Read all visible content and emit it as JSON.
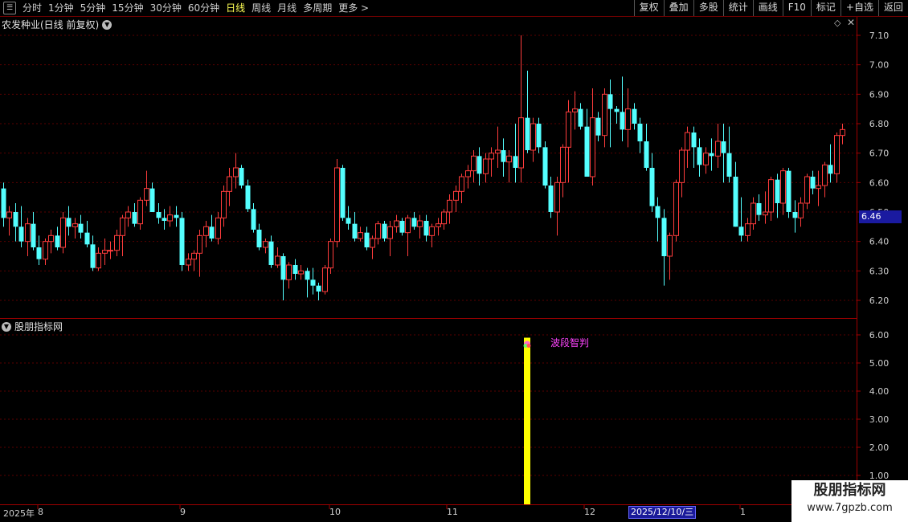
{
  "toolbar": {
    "periods": [
      "分时",
      "1分钟",
      "5分钟",
      "15分钟",
      "30分钟",
      "60分钟",
      "日线",
      "周线",
      "月线",
      "多周期",
      "更多 >"
    ],
    "active_period": "日线",
    "right_buttons": [
      "复权",
      "叠加",
      "多股",
      "统计",
      "画线",
      "F10",
      "标记",
      "+自选",
      "返回"
    ]
  },
  "main_panel": {
    "title": "农发种业(日线 前复权)",
    "y_ticks": [
      "7.10",
      "7.00",
      "6.90",
      "6.80",
      "6.70",
      "6.60",
      "6.50",
      "6.40",
      "6.30",
      "6.20"
    ],
    "current_price": "6.46"
  },
  "indicator_panel": {
    "title": "股朋指标网",
    "y_ticks": [
      "6.00",
      "5.00",
      "4.00",
      "3.00",
      "2.00",
      "1.00"
    ],
    "signal_label": "波段智判"
  },
  "x_axis": {
    "labels": [
      "2025年",
      "8",
      "9",
      "10",
      "11",
      "12",
      "1"
    ],
    "cursor_date": "2025/12/10/三"
  },
  "watermark": {
    "line1": "股朋指标网",
    "line2": "www.7gpzb.com"
  },
  "colors": {
    "up": "#ff3c3c",
    "down": "#54ffff",
    "indicator_bar": "#ffff00",
    "grid": "#5a0000"
  },
  "chart_data": {
    "type": "candlestick",
    "ylim": [
      6.15,
      7.15
    ],
    "candles": [
      [
        6.58,
        6.6,
        6.45,
        6.48
      ],
      [
        6.48,
        6.52,
        6.42,
        6.5
      ],
      [
        6.5,
        6.53,
        6.4,
        6.45
      ],
      [
        6.45,
        6.52,
        6.38,
        6.4
      ],
      [
        6.4,
        6.48,
        6.35,
        6.46
      ],
      [
        6.46,
        6.5,
        6.37,
        6.38
      ],
      [
        6.38,
        6.42,
        6.32,
        6.34
      ],
      [
        6.34,
        6.41,
        6.32,
        6.4
      ],
      [
        6.4,
        6.44,
        6.36,
        6.42
      ],
      [
        6.42,
        6.45,
        6.37,
        6.38
      ],
      [
        6.38,
        6.5,
        6.36,
        6.48
      ],
      [
        6.48,
        6.52,
        6.42,
        6.45
      ],
      [
        6.45,
        6.48,
        6.41,
        6.46
      ],
      [
        6.46,
        6.49,
        6.41,
        6.43
      ],
      [
        6.43,
        6.47,
        6.38,
        6.39
      ],
      [
        6.39,
        6.42,
        6.3,
        6.31
      ],
      [
        6.31,
        6.38,
        6.3,
        6.36
      ],
      [
        6.36,
        6.41,
        6.32,
        6.37
      ],
      [
        6.37,
        6.4,
        6.34,
        6.37
      ],
      [
        6.37,
        6.44,
        6.35,
        6.42
      ],
      [
        6.42,
        6.49,
        6.35,
        6.48
      ],
      [
        6.48,
        6.52,
        6.45,
        6.5
      ],
      [
        6.5,
        6.53,
        6.45,
        6.46
      ],
      [
        6.46,
        6.55,
        6.44,
        6.54
      ],
      [
        6.54,
        6.64,
        6.52,
        6.58
      ],
      [
        6.58,
        6.6,
        6.5,
        6.5
      ],
      [
        6.5,
        6.53,
        6.46,
        6.48
      ],
      [
        6.48,
        6.51,
        6.44,
        6.47
      ],
      [
        6.47,
        6.52,
        6.45,
        6.49
      ],
      [
        6.49,
        6.52,
        6.45,
        6.48
      ],
      [
        6.48,
        6.5,
        6.3,
        6.32
      ],
      [
        6.32,
        6.36,
        6.3,
        6.34
      ],
      [
        6.34,
        6.37,
        6.3,
        6.36
      ],
      [
        6.36,
        6.44,
        6.28,
        6.42
      ],
      [
        6.42,
        6.47,
        6.38,
        6.45
      ],
      [
        6.45,
        6.49,
        6.4,
        6.41
      ],
      [
        6.41,
        6.5,
        6.39,
        6.48
      ],
      [
        6.48,
        6.59,
        6.45,
        6.57
      ],
      [
        6.57,
        6.65,
        6.52,
        6.62
      ],
      [
        6.62,
        6.7,
        6.58,
        6.65
      ],
      [
        6.65,
        6.66,
        6.58,
        6.59
      ],
      [
        6.59,
        6.61,
        6.5,
        6.51
      ],
      [
        6.51,
        6.53,
        6.43,
        6.44
      ],
      [
        6.44,
        6.46,
        6.37,
        6.38
      ],
      [
        6.38,
        6.41,
        6.36,
        6.4
      ],
      [
        6.4,
        6.42,
        6.31,
        6.32
      ],
      [
        6.32,
        6.38,
        6.31,
        6.35
      ],
      [
        6.35,
        6.36,
        6.2,
        6.27
      ],
      [
        6.27,
        6.33,
        6.24,
        6.32
      ],
      [
        6.32,
        6.34,
        6.27,
        6.29
      ],
      [
        6.29,
        6.32,
        6.27,
        6.3
      ],
      [
        6.3,
        6.31,
        6.21,
        6.27
      ],
      [
        6.27,
        6.31,
        6.22,
        6.25
      ],
      [
        6.25,
        6.26,
        6.2,
        6.23
      ],
      [
        6.23,
        6.32,
        6.22,
        6.31
      ],
      [
        6.31,
        6.41,
        6.29,
        6.4
      ],
      [
        6.4,
        6.68,
        6.38,
        6.65
      ],
      [
        6.65,
        6.66,
        6.47,
        6.48
      ],
      [
        6.48,
        6.52,
        6.44,
        6.46
      ],
      [
        6.46,
        6.5,
        6.4,
        6.41
      ],
      [
        6.41,
        6.45,
        6.4,
        6.43
      ],
      [
        6.43,
        6.45,
        6.37,
        6.38
      ],
      [
        6.38,
        6.42,
        6.34,
        6.41
      ],
      [
        6.41,
        6.47,
        6.39,
        6.46
      ],
      [
        6.46,
        6.47,
        6.4,
        6.41
      ],
      [
        6.41,
        6.47,
        6.35,
        6.45
      ],
      [
        6.45,
        6.49,
        6.43,
        6.47
      ],
      [
        6.47,
        6.48,
        6.42,
        6.43
      ],
      [
        6.43,
        6.49,
        6.35,
        6.48
      ],
      [
        6.48,
        6.5,
        6.44,
        6.45
      ],
      [
        6.45,
        6.49,
        6.41,
        6.47
      ],
      [
        6.47,
        6.49,
        6.4,
        6.42
      ],
      [
        6.42,
        6.46,
        6.38,
        6.45
      ],
      [
        6.45,
        6.48,
        6.42,
        6.46
      ],
      [
        6.46,
        6.51,
        6.44,
        6.5
      ],
      [
        6.5,
        6.56,
        6.46,
        6.54
      ],
      [
        6.54,
        6.59,
        6.5,
        6.57
      ],
      [
        6.57,
        6.63,
        6.53,
        6.62
      ],
      [
        6.62,
        6.66,
        6.58,
        6.64
      ],
      [
        6.64,
        6.71,
        6.6,
        6.69
      ],
      [
        6.69,
        6.72,
        6.59,
        6.63
      ],
      [
        6.63,
        6.7,
        6.6,
        6.68
      ],
      [
        6.68,
        6.72,
        6.62,
        6.7
      ],
      [
        6.7,
        6.79,
        6.65,
        6.71
      ],
      [
        6.71,
        6.75,
        6.62,
        6.67
      ],
      [
        6.67,
        6.71,
        6.6,
        6.69
      ],
      [
        6.69,
        6.8,
        6.6,
        6.65
      ],
      [
        6.65,
        7.1,
        6.6,
        6.82
      ],
      [
        6.82,
        6.98,
        6.7,
        6.71
      ],
      [
        6.71,
        6.82,
        6.67,
        6.8
      ],
      [
        6.8,
        6.82,
        6.7,
        6.72
      ],
      [
        6.72,
        6.74,
        6.58,
        6.59
      ],
      [
        6.59,
        6.62,
        6.48,
        6.5
      ],
      [
        6.5,
        6.62,
        6.42,
        6.6
      ],
      [
        6.6,
        6.73,
        6.55,
        6.72
      ],
      [
        6.72,
        6.88,
        6.6,
        6.84
      ],
      [
        6.84,
        6.91,
        6.78,
        6.85
      ],
      [
        6.85,
        6.87,
        6.78,
        6.79
      ],
      [
        6.79,
        6.85,
        6.62,
        6.62
      ],
      [
        6.62,
        6.92,
        6.59,
        6.82
      ],
      [
        6.82,
        6.84,
        6.74,
        6.76
      ],
      [
        6.76,
        6.92,
        6.72,
        6.9
      ],
      [
        6.9,
        6.95,
        6.72,
        6.85
      ],
      [
        6.85,
        6.86,
        6.8,
        6.84
      ],
      [
        6.84,
        6.96,
        6.74,
        6.78
      ],
      [
        6.78,
        6.92,
        6.72,
        6.85
      ],
      [
        6.85,
        6.87,
        6.78,
        6.8
      ],
      [
        6.8,
        6.82,
        6.7,
        6.74
      ],
      [
        6.74,
        6.8,
        6.64,
        6.65
      ],
      [
        6.65,
        6.7,
        6.5,
        6.52
      ],
      [
        6.52,
        6.55,
        6.4,
        6.48
      ],
      [
        6.48,
        6.51,
        6.25,
        6.35
      ],
      [
        6.35,
        6.43,
        6.27,
        6.42
      ],
      [
        6.42,
        6.61,
        6.4,
        6.6
      ],
      [
        6.6,
        6.72,
        6.55,
        6.71
      ],
      [
        6.71,
        6.79,
        6.65,
        6.77
      ],
      [
        6.77,
        6.79,
        6.65,
        6.72
      ],
      [
        6.72,
        6.75,
        6.62,
        6.66
      ],
      [
        6.66,
        6.72,
        6.63,
        6.7
      ],
      [
        6.7,
        6.75,
        6.64,
        6.69
      ],
      [
        6.69,
        6.8,
        6.65,
        6.74
      ],
      [
        6.74,
        6.8,
        6.6,
        6.7
      ],
      [
        6.7,
        6.79,
        6.6,
        6.62
      ],
      [
        6.62,
        6.67,
        6.45,
        6.45
      ],
      [
        6.45,
        6.55,
        6.4,
        6.42
      ],
      [
        6.42,
        6.48,
        6.4,
        6.46
      ],
      [
        6.46,
        6.55,
        6.44,
        6.53
      ],
      [
        6.53,
        6.56,
        6.47,
        6.49
      ],
      [
        6.49,
        6.57,
        6.46,
        6.5
      ],
      [
        6.5,
        6.62,
        6.47,
        6.61
      ],
      [
        6.61,
        6.63,
        6.48,
        6.53
      ],
      [
        6.53,
        6.65,
        6.49,
        6.64
      ],
      [
        6.64,
        6.65,
        6.48,
        6.5
      ],
      [
        6.5,
        6.54,
        6.43,
        6.48
      ],
      [
        6.48,
        6.55,
        6.45,
        6.53
      ],
      [
        6.53,
        6.63,
        6.51,
        6.62
      ],
      [
        6.62,
        6.64,
        6.56,
        6.58
      ],
      [
        6.58,
        6.64,
        6.52,
        6.59
      ],
      [
        6.59,
        6.67,
        6.55,
        6.66
      ],
      [
        6.66,
        6.73,
        6.6,
        6.63
      ],
      [
        6.63,
        6.77,
        6.6,
        6.76
      ],
      [
        6.76,
        6.8,
        6.73,
        6.78
      ]
    ],
    "indicator": {
      "series": "波段智判",
      "signal_index": 88,
      "value": 5.9
    }
  }
}
